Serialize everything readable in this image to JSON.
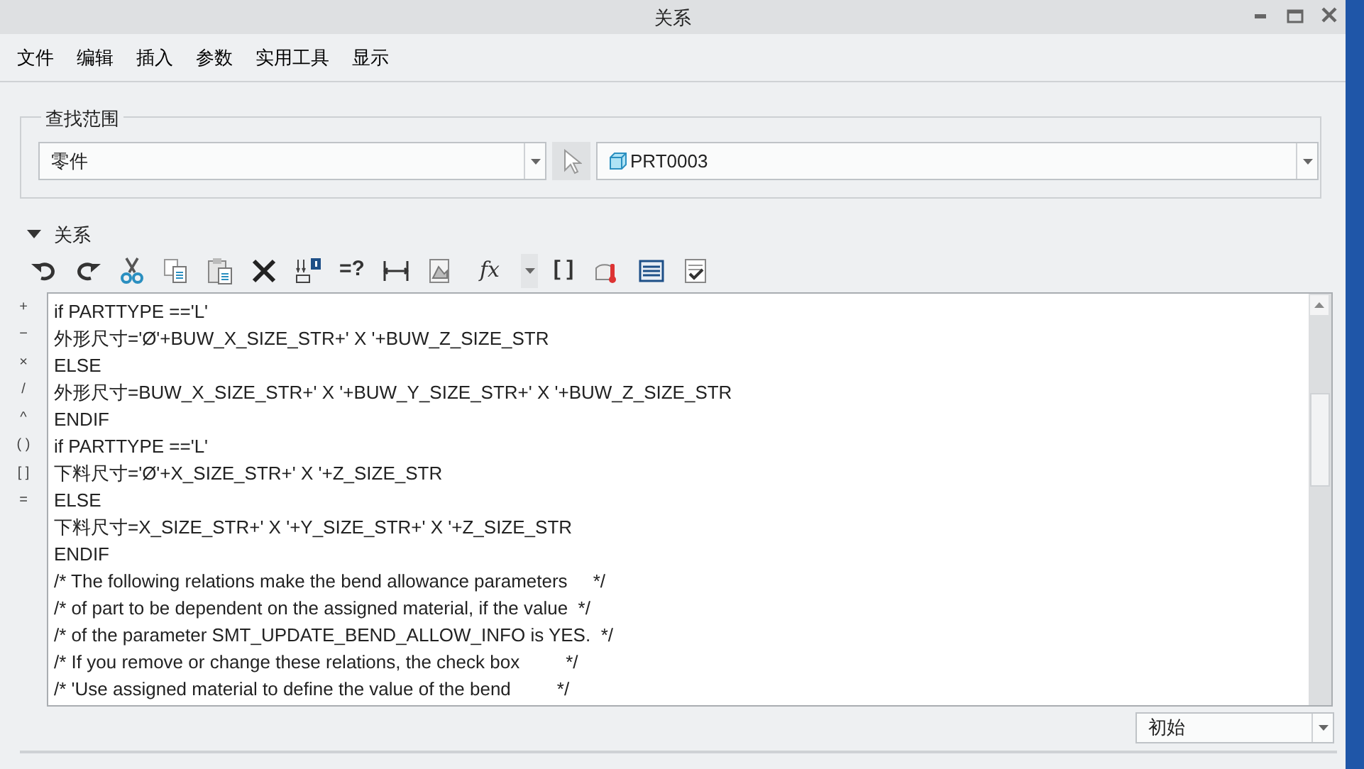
{
  "window": {
    "title": "关系"
  },
  "menu": [
    "文件",
    "编辑",
    "插入",
    "参数",
    "实用工具",
    "显示"
  ],
  "scope": {
    "label": "查找范围",
    "type": "零件",
    "model": "PRT0003"
  },
  "section": {
    "title": "关系",
    "expanded": true
  },
  "toolbar": [
    {
      "kind": "undo"
    },
    {
      "kind": "redo"
    },
    {
      "kind": "cut"
    },
    {
      "kind": "copy"
    },
    {
      "kind": "paste"
    },
    {
      "kind": "delete"
    },
    {
      "kind": "dims"
    },
    {
      "kind": "text",
      "label": "=?"
    },
    {
      "kind": "measure"
    },
    {
      "kind": "sheet"
    },
    {
      "kind": "function",
      "label": "fx"
    },
    {
      "kind": "text",
      "label": "[ ]"
    },
    {
      "kind": "thermo"
    },
    {
      "kind": "list"
    },
    {
      "kind": "verify"
    }
  ],
  "operators": [
    "+",
    "−",
    "×",
    "/",
    "^",
    "( )",
    "[ ]",
    "="
  ],
  "editor_lines": [
    "if PARTTYPE =='L'",
    "外形尺寸='Ø'+BUW_X_SIZE_STR+' X '+BUW_Z_SIZE_STR",
    "ELSE",
    "外形尺寸=BUW_X_SIZE_STR+' X '+BUW_Y_SIZE_STR+' X '+BUW_Z_SIZE_STR",
    "ENDIF",
    "if PARTTYPE =='L'",
    "下料尺寸='Ø'+X_SIZE_STR+' X '+Z_SIZE_STR",
    "ELSE",
    "下料尺寸=X_SIZE_STR+' X '+Y_SIZE_STR+' X '+Z_SIZE_STR",
    "ENDIF",
    "/* The following relations make the bend allowance parameters     */",
    "/* of part to be dependent on the assigned material, if the value  */",
    "/* of the parameter SMT_UPDATE_BEND_ALLOW_INFO is YES.  */",
    "/* If you remove or change these relations, the check box         */",
    "/* 'Use assigned material to define the value of the bend         */"
  ],
  "state_dropdown": {
    "value": "初始"
  }
}
